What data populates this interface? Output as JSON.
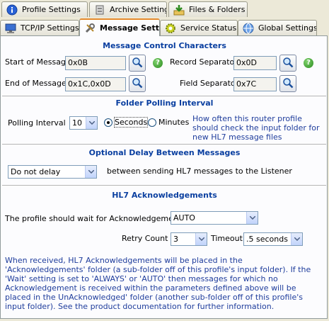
{
  "outer_tabs": [
    {
      "label": "Profile Settings",
      "icon": "info-icon"
    },
    {
      "label": "Archive Settings",
      "icon": "archive-icon"
    },
    {
      "label": "Files & Folders",
      "icon": "folder-download-icon"
    }
  ],
  "inner_tabs": [
    {
      "label": "TCP/IP Settings",
      "icon": "monitor-icon"
    },
    {
      "label": "Message Sett...",
      "icon": "tools-icon",
      "active": true
    },
    {
      "label": "Service Status",
      "icon": "gear-icon"
    },
    {
      "label": "Global Settings",
      "icon": "globe-icon"
    }
  ],
  "message_control": {
    "title": "Message Control Characters",
    "start_label": "Start of Message",
    "start_value": "0x0B",
    "end_label": "End  of Message",
    "end_value": "0x1C,0x0D",
    "record_sep_label": "Record Separator",
    "record_sep_value": "0x0D",
    "field_sep_label": "Field Separator",
    "field_sep_value": "0x7C",
    "help_glyph": "?"
  },
  "folder_polling": {
    "title": "Folder Polling Interval",
    "interval_label": "Polling Interval",
    "interval_value": "10",
    "unit_seconds": "Seconds",
    "unit_minutes": "Minutes",
    "selected_unit": "Seconds",
    "note": "How often this router profile should check the input folder for new HL7 message files"
  },
  "delay": {
    "title": "Optional Delay Between Messages",
    "value": "Do not delay",
    "suffix": "between sending HL7 messages to the Listener"
  },
  "ack": {
    "title": "HL7 Acknowledgements",
    "wait_label": "The profile should wait for Acknowledgements:",
    "wait_value": "AUTO",
    "retry_label": "Retry Count",
    "retry_value": "3",
    "timeout_label": "Timeout",
    "timeout_value": ".5 seconds",
    "note": "When received, HL7 Acknowledgements will be placed in the 'Acknowledgements' folder (a sub-folder off of this profile's input folder).  If the 'Wait' setting is set to 'ALWAYS' or 'AUTO' then messages for which no Acknowledgement is received within the parameters defined above will be placed in the UnAcknowledged' folder (another sub-folder off of this profile's input folder).  See the product documentation for further information."
  },
  "colors": {
    "accent": "#0a3fa0",
    "note_text": "#1f3d9c",
    "tab_highlight": "#e68b2c"
  }
}
